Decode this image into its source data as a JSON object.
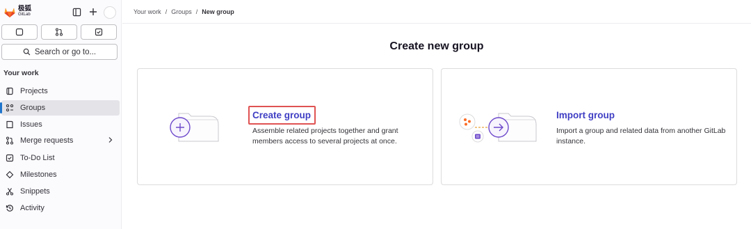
{
  "sidebar": {
    "logo": {
      "cn": "极狐",
      "en": "GitLab"
    },
    "search_label": "Search or go to...",
    "section_title": "Your work",
    "items": [
      {
        "label": "Projects",
        "icon": "project-icon"
      },
      {
        "label": "Groups",
        "icon": "group-icon",
        "active": true
      },
      {
        "label": "Issues",
        "icon": "issues-icon"
      },
      {
        "label": "Merge requests",
        "icon": "merge-request-icon"
      },
      {
        "label": "To-Do List",
        "icon": "todo-icon"
      },
      {
        "label": "Milestones",
        "icon": "milestone-icon"
      },
      {
        "label": "Snippets",
        "icon": "snippet-icon"
      },
      {
        "label": "Activity",
        "icon": "history-icon"
      }
    ]
  },
  "breadcrumb": {
    "items": [
      "Your work",
      "Groups",
      "New group"
    ]
  },
  "page": {
    "title": "Create new group"
  },
  "cards": {
    "create": {
      "title": "Create group",
      "description": "Assemble related projects together and grant members access to several projects at once."
    },
    "import": {
      "title": "Import group",
      "description": "Import a group and related data from another GitLab instance."
    }
  },
  "colors": {
    "accent": "#3f3ec4",
    "highlight": "#e05252",
    "illustration_purple": "#6e49cb",
    "sidebar_active_bar": "#1f75cb"
  }
}
